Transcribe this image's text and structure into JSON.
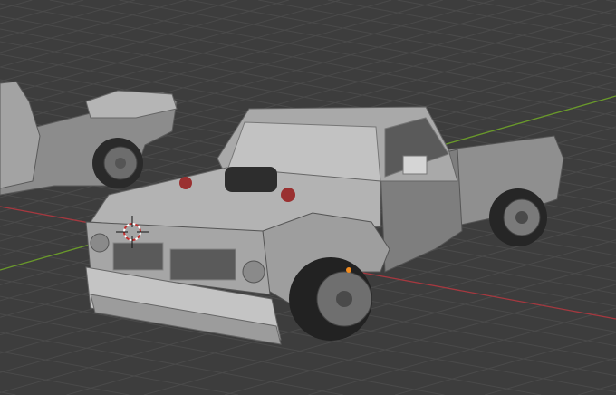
{
  "viewport": {
    "background": "#3d3d3d",
    "grid_color": "#4a4a4a",
    "x_axis_color": "#a5383f",
    "y_axis_color": "#6a9a2a",
    "model_color": "#9a9a9a",
    "origin_color": "#f08a1e"
  },
  "scene": {
    "objects": [
      "truck-main",
      "truck-secondary"
    ],
    "cursor_icon": "3d-cursor-icon"
  }
}
